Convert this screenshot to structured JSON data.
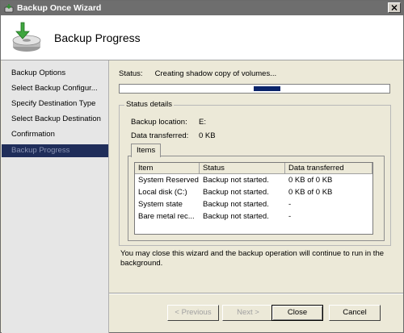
{
  "window": {
    "title": "Backup Once Wizard"
  },
  "header": {
    "title": "Backup Progress"
  },
  "nav": {
    "items": [
      {
        "label": "Backup Options"
      },
      {
        "label": "Select Backup Configur..."
      },
      {
        "label": "Specify Destination Type"
      },
      {
        "label": "Select Backup Destination"
      },
      {
        "label": "Confirmation"
      },
      {
        "label": "Backup Progress",
        "active": true
      }
    ]
  },
  "status": {
    "label": "Status:",
    "value": "Creating shadow copy of volumes..."
  },
  "details": {
    "legend": "Status details",
    "backup_location_label": "Backup location:",
    "backup_location_value": "E:",
    "data_transferred_label": "Data transferred:",
    "data_transferred_value": "0 KB",
    "tab_label": "Items",
    "columns": [
      "Item",
      "Status",
      "Data transferred"
    ],
    "rows": [
      {
        "item": "System Reserved",
        "status": "Backup not started.",
        "data": "0 KB of 0 KB"
      },
      {
        "item": "Local disk (C:)",
        "status": "Backup not started.",
        "data": "0 KB of 0 KB"
      },
      {
        "item": "System state",
        "status": "Backup not started.",
        "data": "-"
      },
      {
        "item": "Bare metal rec...",
        "status": "Backup not started.",
        "data": "-"
      }
    ]
  },
  "note": "You may close this wizard and the backup operation will continue to run in the background.",
  "buttons": {
    "previous": "< Previous",
    "next": "Next >",
    "close": "Close",
    "cancel": "Cancel"
  },
  "colors": {
    "nav_active_bg": "#1f2d5a",
    "progress_block": "#0a246a",
    "titlebar": "#6e6e6e"
  },
  "icons": {
    "titlebar": "backup-app-icon",
    "header": "backup-disk-icon",
    "close": "close-icon"
  }
}
